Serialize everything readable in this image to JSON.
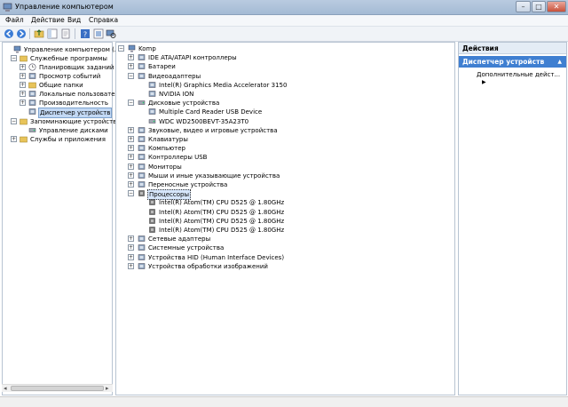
{
  "window": {
    "title": "Управление компьютером",
    "minimize": "–",
    "maximize": "□",
    "close": "✕"
  },
  "menu": [
    "Файл",
    "Действие",
    "Вид",
    "Справка"
  ],
  "left_tree": [
    {
      "label": "Управление компьютером (лока",
      "level": 0,
      "expander": ""
    },
    {
      "label": "Служебные программы",
      "level": 1,
      "expander": "−"
    },
    {
      "label": "Планировщик заданий",
      "level": 2,
      "expander": "+"
    },
    {
      "label": "Просмотр событий",
      "level": 2,
      "expander": "+"
    },
    {
      "label": "Общие папки",
      "level": 2,
      "expander": "+"
    },
    {
      "label": "Локальные пользовател",
      "level": 2,
      "expander": "+"
    },
    {
      "label": "Производительность",
      "level": 2,
      "expander": "+"
    },
    {
      "label": "Диспетчер устройств",
      "level": 2,
      "expander": ""
    },
    {
      "label": "Запоминающие устройства",
      "level": 1,
      "expander": "−"
    },
    {
      "label": "Управление дисками",
      "level": 2,
      "expander": ""
    },
    {
      "label": "Службы и приложения",
      "level": 1,
      "expander": "+"
    }
  ],
  "device_tree": [
    {
      "label": "Komp",
      "level": 0,
      "expander": "−"
    },
    {
      "label": "IDE ATA/ATAPI контроллеры",
      "level": 1,
      "expander": "+"
    },
    {
      "label": "Батареи",
      "level": 1,
      "expander": "+"
    },
    {
      "label": "Видеоадаптеры",
      "level": 1,
      "expander": "−"
    },
    {
      "label": "Intel(R) Graphics Media Accelerator 3150",
      "level": 2,
      "expander": ""
    },
    {
      "label": "NVIDIA ION",
      "level": 2,
      "expander": ""
    },
    {
      "label": "Дисковые устройства",
      "level": 1,
      "expander": "−"
    },
    {
      "label": "Multiple Card  Reader USB Device",
      "level": 2,
      "expander": ""
    },
    {
      "label": "WDC WD2500BEVT-35A23T0",
      "level": 2,
      "expander": ""
    },
    {
      "label": "Звуковые, видео и игровые устройства",
      "level": 1,
      "expander": "+"
    },
    {
      "label": "Клавиатуры",
      "level": 1,
      "expander": "+"
    },
    {
      "label": "Компьютер",
      "level": 1,
      "expander": "+"
    },
    {
      "label": "Контроллеры USB",
      "level": 1,
      "expander": "+"
    },
    {
      "label": "Мониторы",
      "level": 1,
      "expander": "+"
    },
    {
      "label": "Мыши и иные указывающие устройства",
      "level": 1,
      "expander": "+"
    },
    {
      "label": "Переносные устройства",
      "level": 1,
      "expander": "+"
    },
    {
      "label": "Процессоры",
      "level": 1,
      "expander": "−"
    },
    {
      "label": "Intel(R) Atom(TM) CPU D525   @ 1.80GHz",
      "level": 2,
      "expander": ""
    },
    {
      "label": "Intel(R) Atom(TM) CPU D525   @ 1.80GHz",
      "level": 2,
      "expander": ""
    },
    {
      "label": "Intel(R) Atom(TM) CPU D525   @ 1.80GHz",
      "level": 2,
      "expander": ""
    },
    {
      "label": "Intel(R) Atom(TM) CPU D525   @ 1.80GHz",
      "level": 2,
      "expander": ""
    },
    {
      "label": "Сетевые адаптеры",
      "level": 1,
      "expander": "+"
    },
    {
      "label": "Системные устройства",
      "level": 1,
      "expander": "+"
    },
    {
      "label": "Устройства HID (Human Interface Devices)",
      "level": 1,
      "expander": "+"
    },
    {
      "label": "Устройства обработки изображений",
      "level": 1,
      "expander": "+"
    }
  ],
  "actions": {
    "header": "Действия",
    "section": "Диспетчер устройств",
    "section_arrow": "▲",
    "item": "Дополнительные дейст...",
    "item_arrow": "▶"
  },
  "colors": {
    "selection": "#3f7fd1",
    "titlebar": "#a4bad4"
  }
}
